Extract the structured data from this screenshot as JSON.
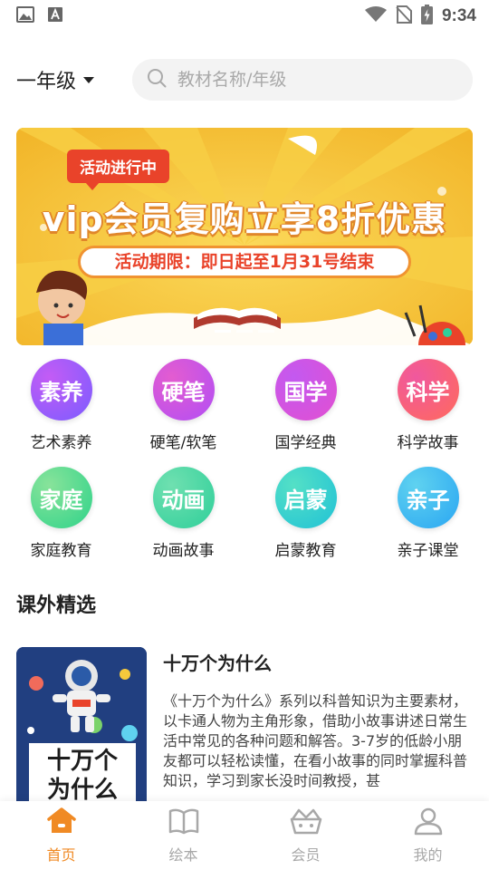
{
  "status_bar": {
    "time": "9:34"
  },
  "header": {
    "grade_label": "一年级",
    "search_placeholder": "教材名称/年级"
  },
  "banner": {
    "tag": "活动进行中",
    "headline": "vip会员复购立享8折优惠",
    "period": "活动期限：即日起至1月31号结束",
    "slide_count": 3,
    "active_slide": 1
  },
  "categories": [
    {
      "icon_text": "素养",
      "label": "艺术素养",
      "color_a": "#7b5cff",
      "color_b": "#c35cf5"
    },
    {
      "icon_text": "硬笔",
      "label": "硬笔/软笔",
      "color_a": "#b24ef5",
      "color_b": "#e35cd0"
    },
    {
      "icon_text": "国学",
      "label": "国学经典",
      "color_a": "#e24fd1",
      "color_b": "#c359f0"
    },
    {
      "icon_text": "科学",
      "label": "科学故事",
      "color_a": "#ff6a5c",
      "color_b": "#f0589e"
    },
    {
      "icon_text": "家庭",
      "label": "家庭教育",
      "color_a": "#2fd38a",
      "color_b": "#88e39a"
    },
    {
      "icon_text": "动画",
      "label": "动画故事",
      "color_a": "#2fcf9a",
      "color_b": "#6fe0b0"
    },
    {
      "icon_text": "启蒙",
      "label": "启蒙教育",
      "color_a": "#20c2d6",
      "color_b": "#54e0c6"
    },
    {
      "icon_text": "亲子",
      "label": "亲子课堂",
      "color_a": "#2aa6f2",
      "color_b": "#5fd2f0"
    }
  ],
  "section": {
    "title": "课外精选"
  },
  "book": {
    "title": "十万个为什么",
    "cover_text": "十万个为什么",
    "description": "《十万个为什么》系列以科普知识为主要素材，以卡通人物为主角形象，借助小故事讲述日常生活中常见的各种问题和解答。3-7岁的低龄小朋友都可以轻松读懂，在看小故事的同时掌握科普知识，学习到家长没时间教授，甚"
  },
  "bottom_nav": [
    {
      "label": "首页",
      "icon": "home-icon",
      "active": true
    },
    {
      "label": "绘本",
      "icon": "book-icon",
      "active": false
    },
    {
      "label": "会员",
      "icon": "crown-basket-icon",
      "active": false
    },
    {
      "label": "我的",
      "icon": "profile-icon",
      "active": false
    }
  ],
  "colors": {
    "accent": "#f08a24",
    "banner_bg": "#f6c93c",
    "banner_red": "#e9432a"
  }
}
